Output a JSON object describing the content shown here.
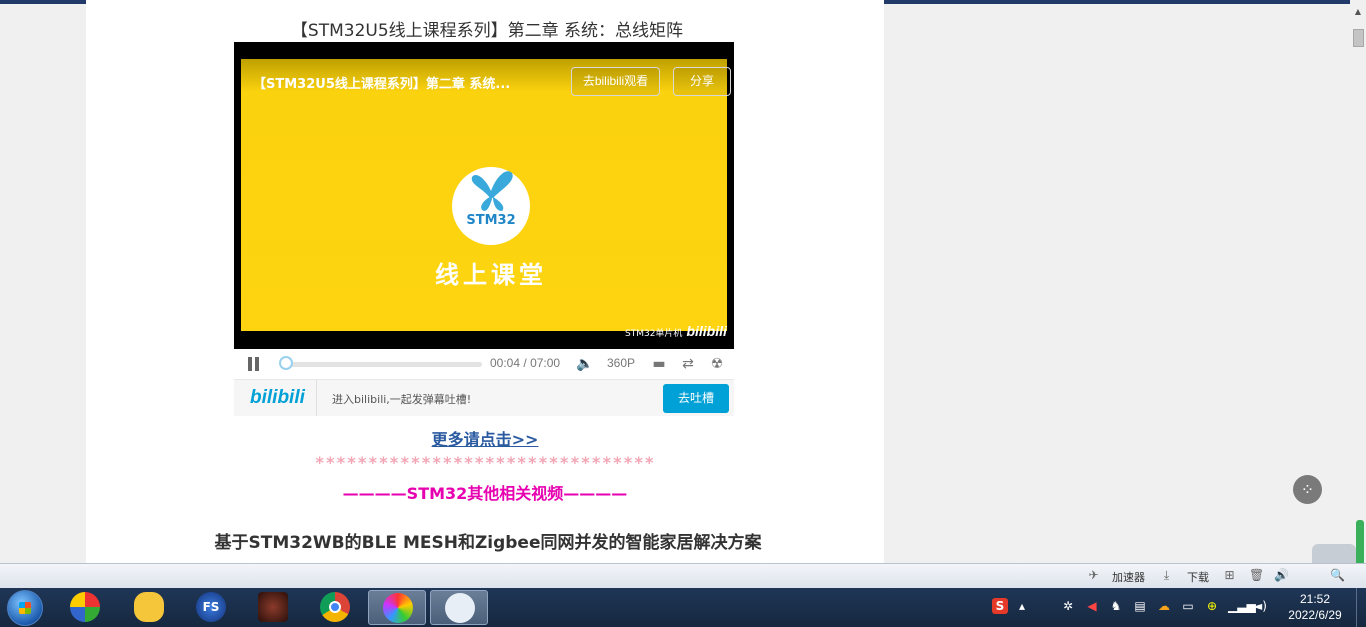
{
  "article": {
    "title": "【STM32U5线上课程系列】第二章 系统：总线矩阵",
    "more_link": "更多请点击>>",
    "stars": "********************************",
    "related_heading": "————STM32其他相关视频————",
    "subheading": "基于STM32WB的BLE MESH和Zigbee同网并发的智能家居解决方案"
  },
  "player": {
    "video_title": "【STM32U5线上课程系列】第二章 系统...",
    "watch_button": "去bilibili观看",
    "share_button": "分享",
    "logo_text": "STM32",
    "class_label": "线上课堂",
    "watermark_channel": "STM32单片机",
    "watermark_brand": "bilibili",
    "current_time": "00:04",
    "time_separator": "/",
    "duration": "07:00",
    "progress_fraction": 0.01,
    "quality": "360P",
    "brand_logo": "bilibili",
    "danmaku_hint": "进入bilibili,一起发弹幕吐槽!",
    "send_button": "去吐槽"
  },
  "statusbar": {
    "accelerator": "加速器",
    "download": "下载"
  },
  "taskbar": {
    "time": "21:52",
    "date": "2022/6/29"
  },
  "colors": {
    "video_yellow": "#fdd40f",
    "bilibili_blue": "#00a1d6",
    "link_blue": "#2a5aa0",
    "magenta": "#e600b0",
    "stars_pink": "#f2a6b6"
  }
}
